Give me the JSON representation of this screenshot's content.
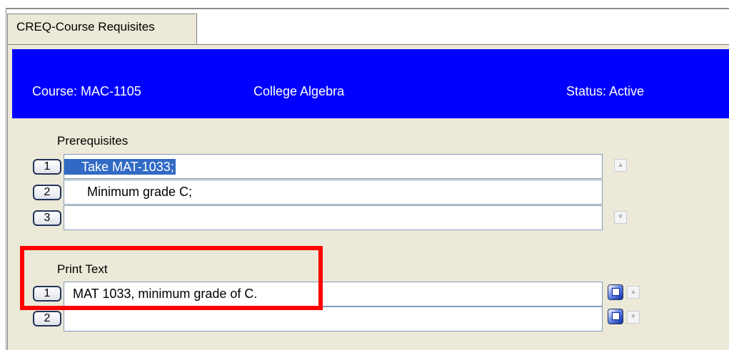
{
  "tab": {
    "label": "CREQ-Course Requisites"
  },
  "header": {
    "course": "Course:  MAC-1105",
    "title": "College Algebra",
    "status": "Status:  Active"
  },
  "prerequisites": {
    "label": "Prerequisites",
    "rows": [
      {
        "num": "1",
        "value": "Take MAT-1033;"
      },
      {
        "num": "2",
        "value": "Minimum grade C;"
      },
      {
        "num": "3",
        "value": ""
      }
    ]
  },
  "print_text": {
    "label": "Print Text",
    "rows": [
      {
        "num": "1",
        "value": "MAT 1033, minimum grade of C."
      },
      {
        "num": "2",
        "value": ""
      }
    ]
  },
  "icons": {
    "scroll_up": "scroll-up-arrow",
    "scroll_down": "scroll-down-arrow",
    "detail": "detail-window-icon"
  },
  "colors": {
    "header_band": "#0000ff",
    "panel": "#ece9d8",
    "selection": "#316ac5",
    "annotation_box": "#ff0000"
  }
}
